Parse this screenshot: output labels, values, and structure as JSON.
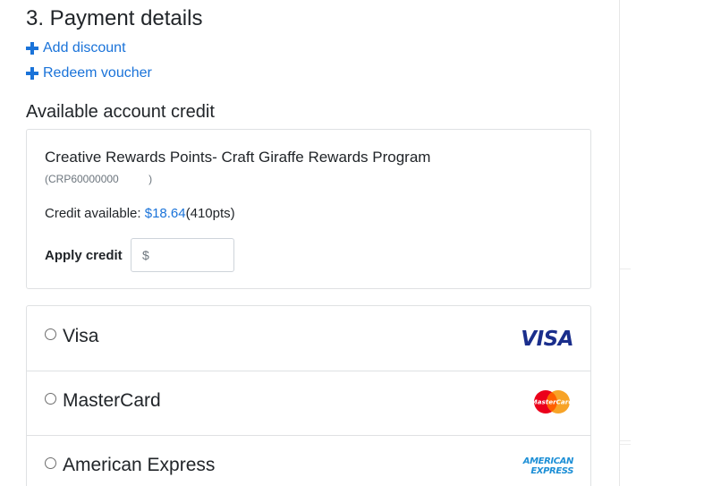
{
  "payment": {
    "title": "3. Payment details",
    "add_discount": "Add discount",
    "redeem_voucher": "Redeem voucher"
  },
  "credit": {
    "title": "Available account credit",
    "program_name": "Creative Rewards Points- Craft Giraffe Rewards Program",
    "program_id": "(CRP60000000          )",
    "available_label": "Credit available: ",
    "available_amount": "$18.64",
    "available_points": "(410pts)",
    "apply_label": "Apply credit",
    "apply_placeholder": "$"
  },
  "methods": [
    {
      "label": "Visa",
      "logo": "visa-logo",
      "logo_text": "VISA",
      "selected": false
    },
    {
      "label": "MasterCard",
      "logo": "mastercard-logo",
      "logo_text": "MasterCard",
      "selected": false
    },
    {
      "label": "American Express",
      "logo": "amex-logo",
      "logo_text_1": "AMERICAN",
      "logo_text_2": "EXPRESS",
      "selected": false
    }
  ],
  "colors": {
    "link": "#1a73d9",
    "visa_blue": "#1a2e8c",
    "visa_gold": "#f2ae14",
    "mc_red": "#eb001b",
    "mc_orange": "#f79e1b",
    "amex_blue": "#1d8fd6"
  }
}
